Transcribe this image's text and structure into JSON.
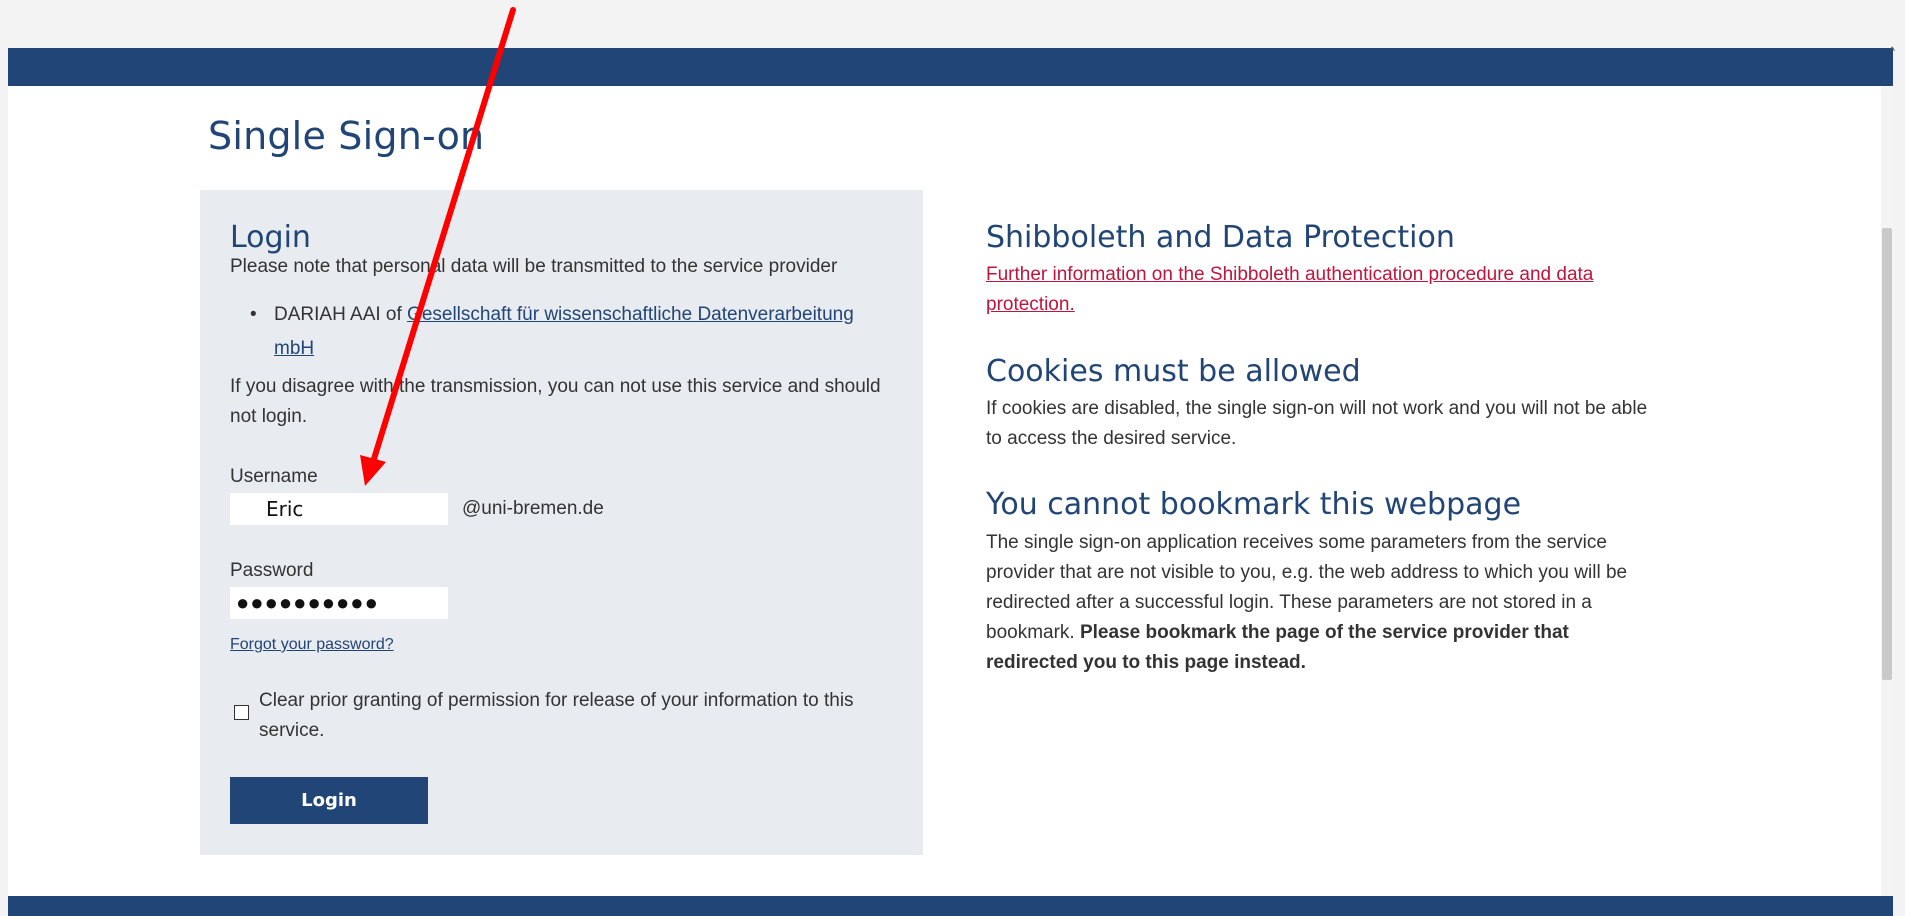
{
  "page": {
    "title": "Single Sign-on"
  },
  "login": {
    "heading": "Login",
    "intro": "Please note that personal data will be transmitted to the service provider",
    "provider_prefix": "DARIAH AAI of ",
    "provider_link": "Gesellschaft für wissenschaftliche Datenverarbeitung mbH",
    "disagree_text": "If you disagree with the transmission, you can not use this service and should not login.",
    "username_label": "Username",
    "username_value": "Eric",
    "username_suffix": "@uni-bremen.de",
    "password_label": "Password",
    "password_mask": "●●●●●●●●●●",
    "forgot_link": "Forgot your password?",
    "clear_permission_label": "Clear prior granting of permission for release of your information to this service.",
    "clear_permission_checked": false,
    "submit_label": "Login"
  },
  "info": {
    "shibboleth_heading": "Shibboleth and Data Protection",
    "shibboleth_link": "Further information on the Shibboleth authentication procedure and data protection.",
    "cookies_heading": "Cookies must be allowed",
    "cookies_text": "If cookies are disabled, the single sign-on will not work and you will not be able to access the desired service.",
    "bookmark_heading": "You cannot bookmark this webpage",
    "bookmark_text": "The single sign-on application receives some parameters from the service provider that are not visible to you, e.g. the web address to which you will be redirected after a successful login. These parameters are not stored in a bookmark. ",
    "bookmark_bold": "Please bookmark the page of the service provider that redirected you to this page instead."
  },
  "colors": {
    "brand_blue": "#214576",
    "panel_bg": "#e8ebef",
    "link_red": "#c0143c",
    "annotation_arrow": "#ff0000"
  },
  "icons": {
    "annotation": "red-arrow-icon",
    "bullet": "bullet-icon",
    "checkbox": "checkbox-icon"
  }
}
